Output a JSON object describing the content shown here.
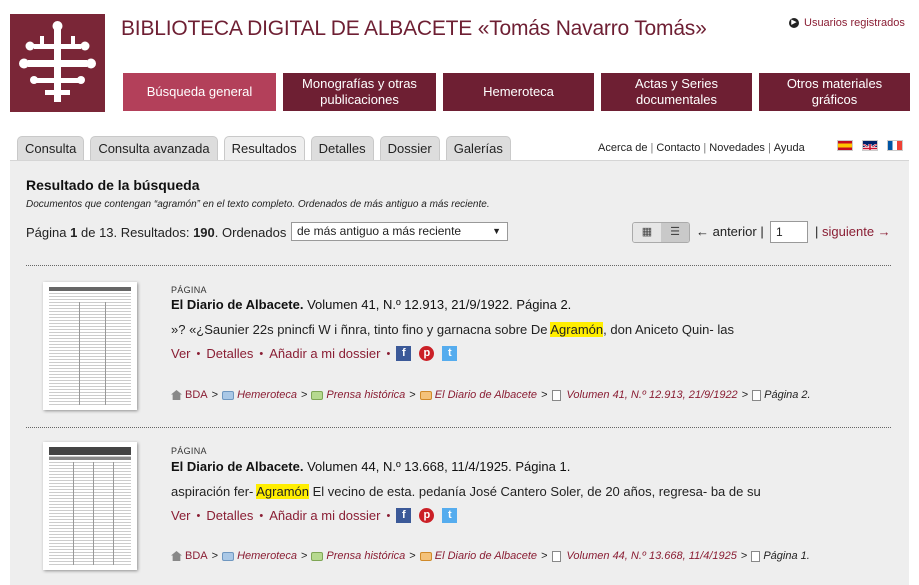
{
  "header": {
    "title": "BIBLIOTECA DIGITAL DE ALBACETE «Tomás Navarro Tomás»",
    "registered_label": "Usuarios registrados",
    "brand_color": "#6e1f33",
    "active_color": "#b3405a"
  },
  "mainnav": [
    {
      "label": "Búsqueda general"
    },
    {
      "label": "Monografías y otras publicaciones"
    },
    {
      "label": "Hemeroteca"
    },
    {
      "label": "Actas y Series documentales"
    },
    {
      "label": "Otros materiales gráficos"
    }
  ],
  "tabs": [
    {
      "label": "Consulta"
    },
    {
      "label": "Consulta avanzada"
    },
    {
      "label": "Resultados"
    },
    {
      "label": "Detalles"
    },
    {
      "label": "Dossier"
    },
    {
      "label": "Galerías"
    }
  ],
  "toplinks": [
    {
      "label": "Acerca de"
    },
    {
      "label": "Contacto"
    },
    {
      "label": "Novedades"
    },
    {
      "label": "Ayuda"
    }
  ],
  "results": {
    "heading": "Resultado de la búsqueda",
    "description": "Documentos que contengan “agramón” en el texto completo. Ordenados de más antiguo a más reciente.",
    "page_label": "Página",
    "page": "1",
    "of_label": "de",
    "total_pages": "13",
    "results_label": "Resultados:",
    "total_results": "190",
    "sort_label": "Ordenados",
    "sort_value": "de más antiguo a más reciente",
    "prev_label": "← anterior",
    "page_input_value": "1",
    "next_label": "siguiente →"
  },
  "items": [
    {
      "type": "PÁGINA",
      "title_bold": "El Diario de Albacete.",
      "title_rest": " Volumen 41, N.º 12.913, 21/9/1922. Página 2.",
      "snippet_before": "»? «¿Saunier 22s pnincfi W i ñnra, tinto fino y garnacna sobre De ",
      "snippet_highlight": "Agramón",
      "snippet_after": ", don Aniceto Quin- las",
      "actions": {
        "view": "Ver",
        "details": "Detalles",
        "add": "Añadir a mi dossier"
      },
      "crumbs": {
        "c1": "BDA",
        "c2": "Hemeroteca",
        "c3": "Prensa histórica",
        "c4": "El Diario de Albacete",
        "c5": "Volumen 41, N.º 12.913, 21/9/1922",
        "c6": "Página 2."
      }
    },
    {
      "type": "PÁGINA",
      "title_bold": "El Diario de Albacete.",
      "title_rest": " Volumen 44, N.º 13.668, 11/4/1925. Página 1.",
      "snippet_before": "aspiración fer- ",
      "snippet_highlight": "Agramón",
      "snippet_after": " El vecino de esta. pedanía José Cantero Soler, de 20 años, regresa- ba de su",
      "actions": {
        "view": "Ver",
        "details": "Detalles",
        "add": "Añadir a mi dossier"
      },
      "crumbs": {
        "c1": "BDA",
        "c2": "Hemeroteca",
        "c3": "Prensa histórica",
        "c4": "El Diario de Albacete",
        "c5": "Volumen 44, N.º 13.668, 11/4/1925",
        "c6": "Página 1."
      }
    }
  ]
}
